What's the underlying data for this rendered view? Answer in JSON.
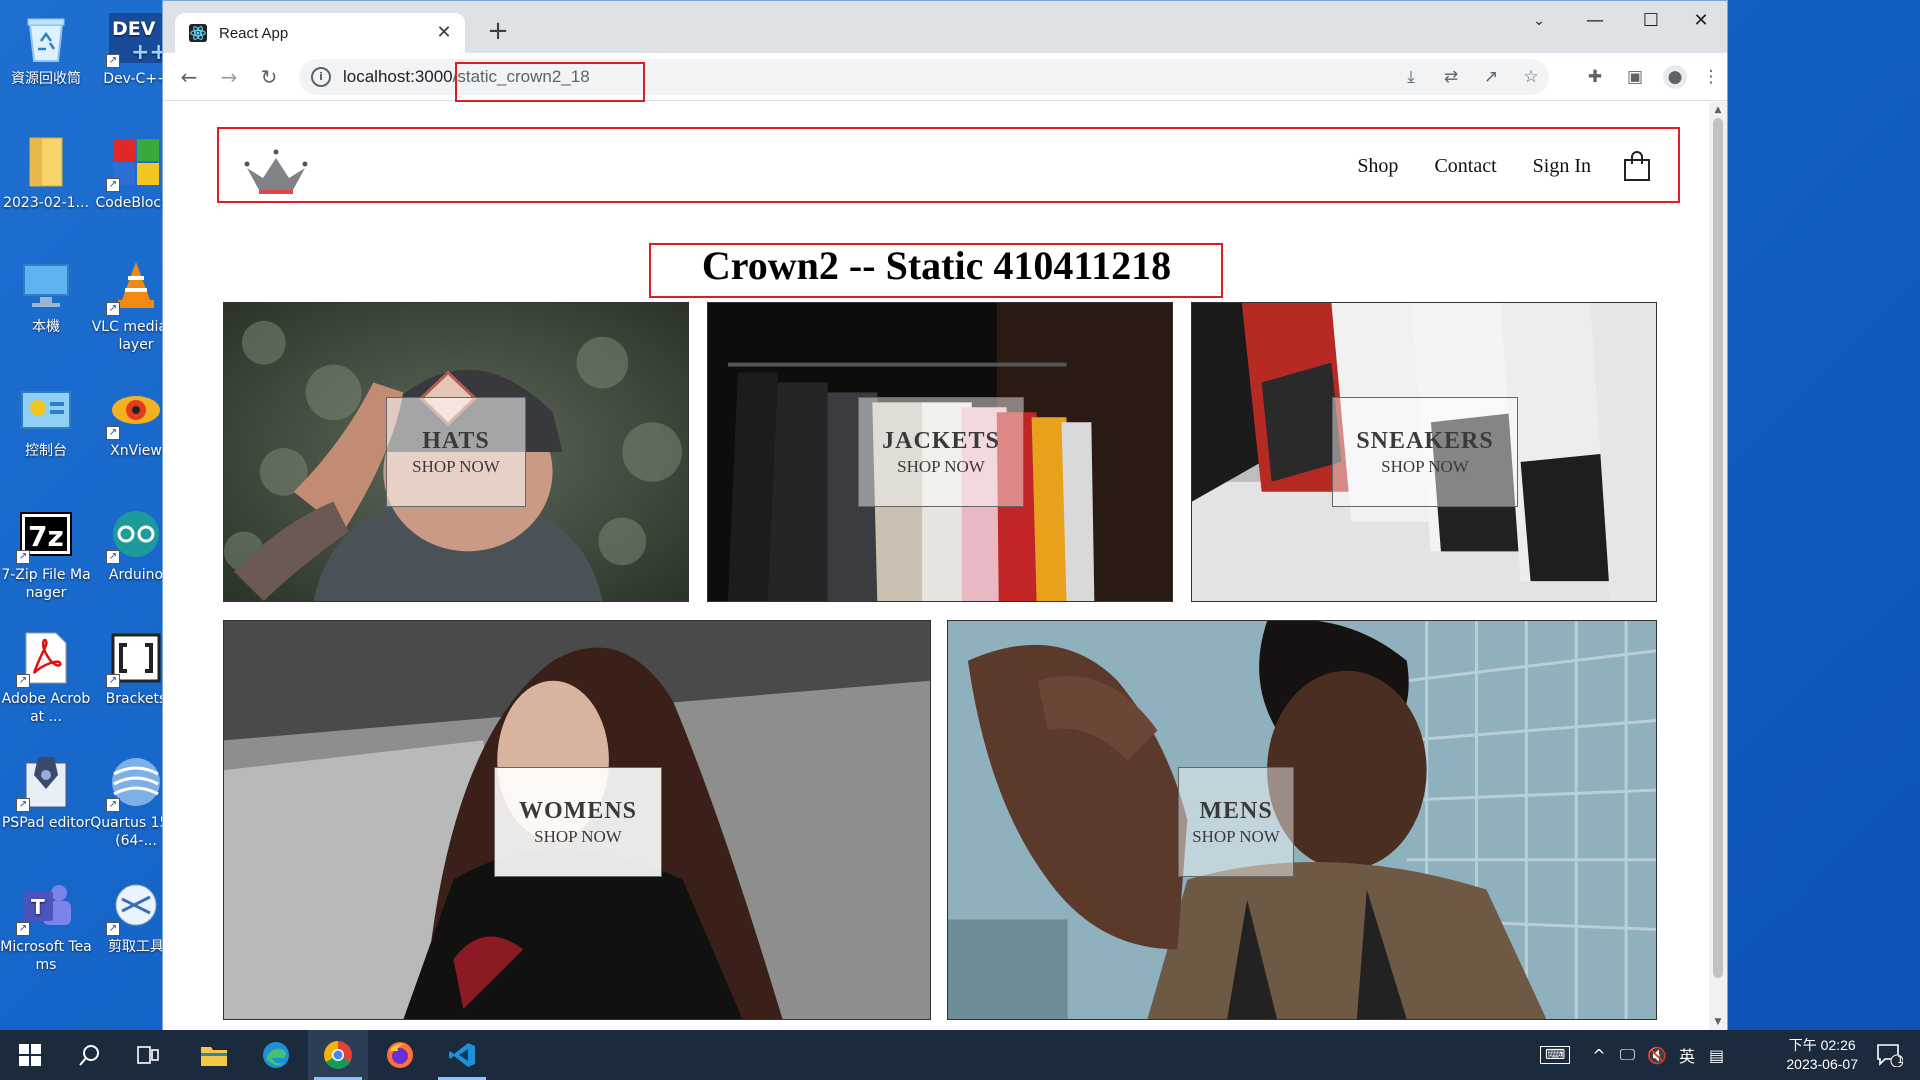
{
  "desktop": {
    "icons": [
      {
        "label": "資源回收筒",
        "icon": "recycle-bin-icon"
      },
      {
        "label": "Dev-C++",
        "icon": "devcpp-icon"
      },
      {
        "label": "2023-02-1...",
        "icon": "folder-icon"
      },
      {
        "label": "CodeBlocks",
        "icon": "codeblocks-icon"
      },
      {
        "label": "本機",
        "icon": "this-pc-icon"
      },
      {
        "label": "VLC media player",
        "icon": "vlc-icon"
      },
      {
        "label": "控制台",
        "icon": "control-panel-icon"
      },
      {
        "label": "XnView",
        "icon": "xnview-icon"
      },
      {
        "label": "7-Zip File Manager",
        "icon": "7zip-icon"
      },
      {
        "label": "Arduino",
        "icon": "arduino-icon"
      },
      {
        "label": "Adobe Acrobat ...",
        "icon": "acrobat-icon"
      },
      {
        "label": "Brackets",
        "icon": "brackets-icon"
      },
      {
        "label": "PSPad editor",
        "icon": "pspad-icon"
      },
      {
        "label": "Quartus 15.0 (64-...",
        "icon": "quartus-icon"
      },
      {
        "label": "Microsoft Teams",
        "icon": "teams-icon"
      },
      {
        "label": "剪取工具",
        "icon": "snipping-tool-icon"
      }
    ]
  },
  "browser": {
    "tab_title": "React App",
    "url_host": "localhost:3000",
    "url_path": "/static_crown2_18",
    "close_glyph": "✕",
    "newtab_glyph": "+"
  },
  "app": {
    "nav": {
      "shop": "Shop",
      "contact": "Contact",
      "signin": "Sign In"
    },
    "page_title": "Crown2 -- Static 410411218",
    "categories": [
      {
        "title": "HATS",
        "subtitle": "SHOP NOW"
      },
      {
        "title": "JACKETS",
        "subtitle": "SHOP NOW"
      },
      {
        "title": "SNEAKERS",
        "subtitle": "SHOP NOW"
      },
      {
        "title": "WOMENS",
        "subtitle": "SHOP NOW"
      },
      {
        "title": "MENS",
        "subtitle": "SHOP NOW"
      }
    ]
  },
  "taskbar": {
    "ime_mode": "英",
    "time": "下午 02:26",
    "date": "2023-06-07",
    "notification_count": "1"
  }
}
